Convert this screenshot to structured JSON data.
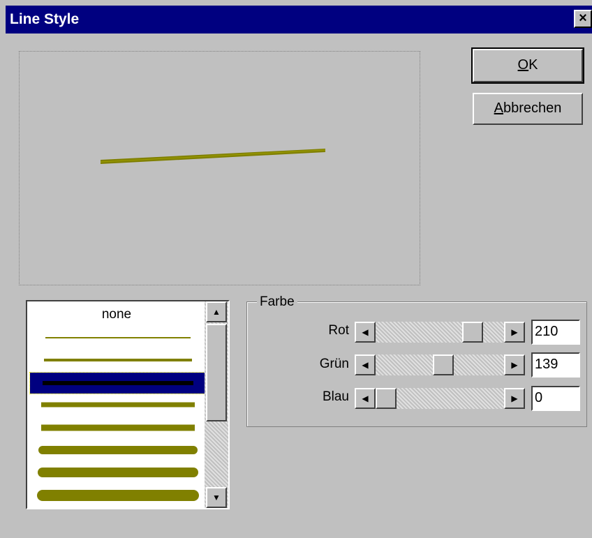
{
  "window": {
    "title": "Line Style",
    "close_glyph": "×"
  },
  "buttons": {
    "ok_mnemonic": "O",
    "ok_rest": "K",
    "cancel_mnemonic": "A",
    "cancel_rest": "bbrechen"
  },
  "line_list": {
    "none_label": "none",
    "selected_index": 3,
    "items": [
      "none",
      "width-1",
      "width-2",
      "width-3",
      "width-4",
      "width-5",
      "width-6",
      "width-7",
      "width-8"
    ]
  },
  "color_group": {
    "title": "Farbe",
    "sliders": [
      {
        "label": "Rot",
        "value": "210",
        "fraction": 0.82
      },
      {
        "label": "Grün",
        "value": "139",
        "fraction": 0.55
      },
      {
        "label": "Blau",
        "value": "0",
        "fraction": 0.0
      }
    ]
  },
  "colors": {
    "line_color": "#808000",
    "selection": "#000080",
    "titlebar": "#000080"
  },
  "icons": {
    "scroll_up": "▲",
    "scroll_down": "▼",
    "scroll_left": "◀",
    "scroll_right": "▶"
  }
}
